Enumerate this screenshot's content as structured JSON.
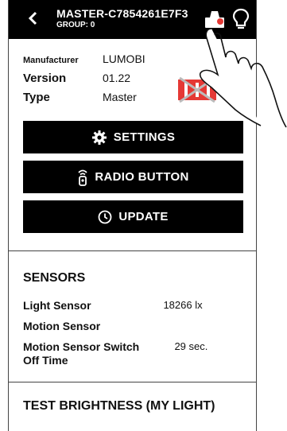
{
  "header": {
    "back_icon": "chevron-left-icon",
    "title": "MASTER-C7854261E7F3",
    "subtitle": "GROUP: 0",
    "icons": [
      "identify-lamp-icon",
      "light-bulb-icon"
    ]
  },
  "info": {
    "manufacturer_label": "Manufacturer",
    "manufacturer_value": "LUMOBI",
    "version_label": "Version",
    "version_value": "01.22",
    "type_label": "Type",
    "type_value": "Master"
  },
  "buttons": {
    "settings_label": "SETTINGS",
    "radio_label": "RADIO BUTTON",
    "update_label": "UPDATE"
  },
  "sensors": {
    "title": "SENSORS",
    "items": [
      {
        "label": "Light Sensor",
        "value": "18266 lx"
      },
      {
        "label": "Motion Sensor",
        "value": ""
      },
      {
        "label": "Motion Sensor Switch Off Time",
        "value": "29 sec."
      }
    ]
  },
  "test": {
    "title": "TEST BRIGHTNESS (MY LIGHT)"
  },
  "colors": {
    "bar": "#000000",
    "accent_red": "#e53935"
  }
}
